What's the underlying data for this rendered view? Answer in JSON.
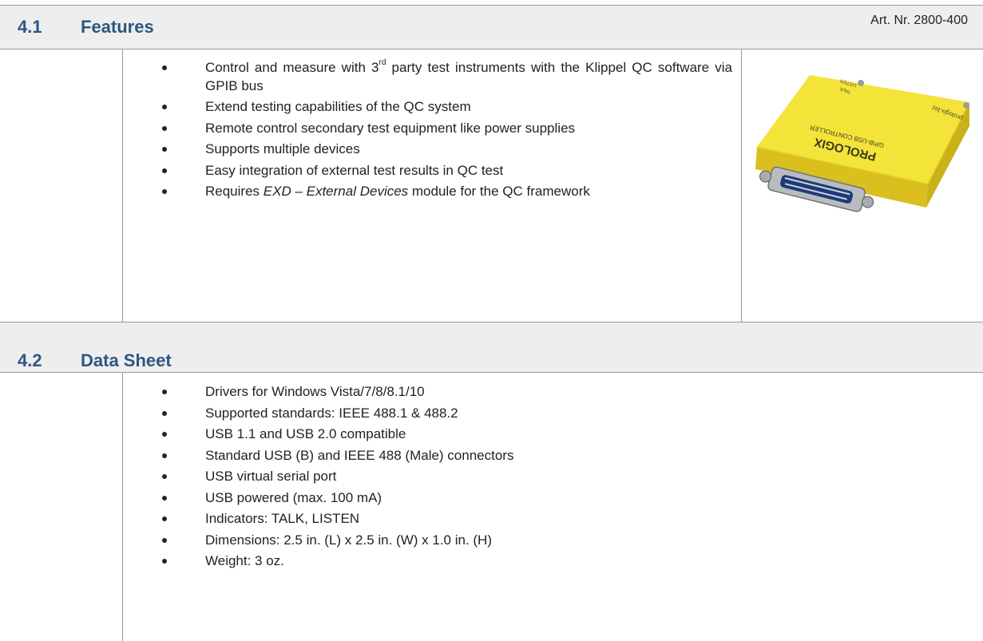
{
  "features": {
    "number": "4.1",
    "title": "Features",
    "article": "Art. Nr. 2800-400",
    "bullets": [
      {
        "pre": "Control and measure with 3",
        "sup": "rd",
        "post": " party test instruments with the Klippel QC software via GPIB bus"
      },
      {
        "text": "Extend testing capabilities of the QC system"
      },
      {
        "text": "Remote control secondary test equipment like power supplies"
      },
      {
        "text": "Supports multiple devices"
      },
      {
        "text": "Easy integration of external test results in QC test"
      },
      {
        "pre": "Requires ",
        "em": "EXD – External Devices",
        "post": " module for the QC framework"
      }
    ],
    "device": {
      "brand": "PROLOGIX",
      "model": "GPIB-USB CONTROLLER",
      "site": "prologix.biz",
      "led_talk": "TALK",
      "led_listen": "LISTEN",
      "body_color": "#f2e12a"
    }
  },
  "datasheet": {
    "number": "4.2",
    "title": "Data Sheet",
    "bullets": [
      "Drivers for Windows Vista/7/8/8.1/10",
      "Supported standards: IEEE 488.1 & 488.2",
      "USB 1.1 and USB 2.0 compatible",
      "Standard USB (B) and IEEE 488 (Male) connectors",
      "USB virtual serial port",
      "USB powered (max. 100 mA)",
      "Indicators: TALK, LISTEN",
      "Dimensions: 2.5 in. (L) x 2.5 in. (W) x 1.0 in. (H)",
      "Weight: 3 oz."
    ]
  },
  "colors": {
    "heading": "#2c5783",
    "header_bg": "#eeeeee",
    "rule": "#9a9a9a"
  }
}
